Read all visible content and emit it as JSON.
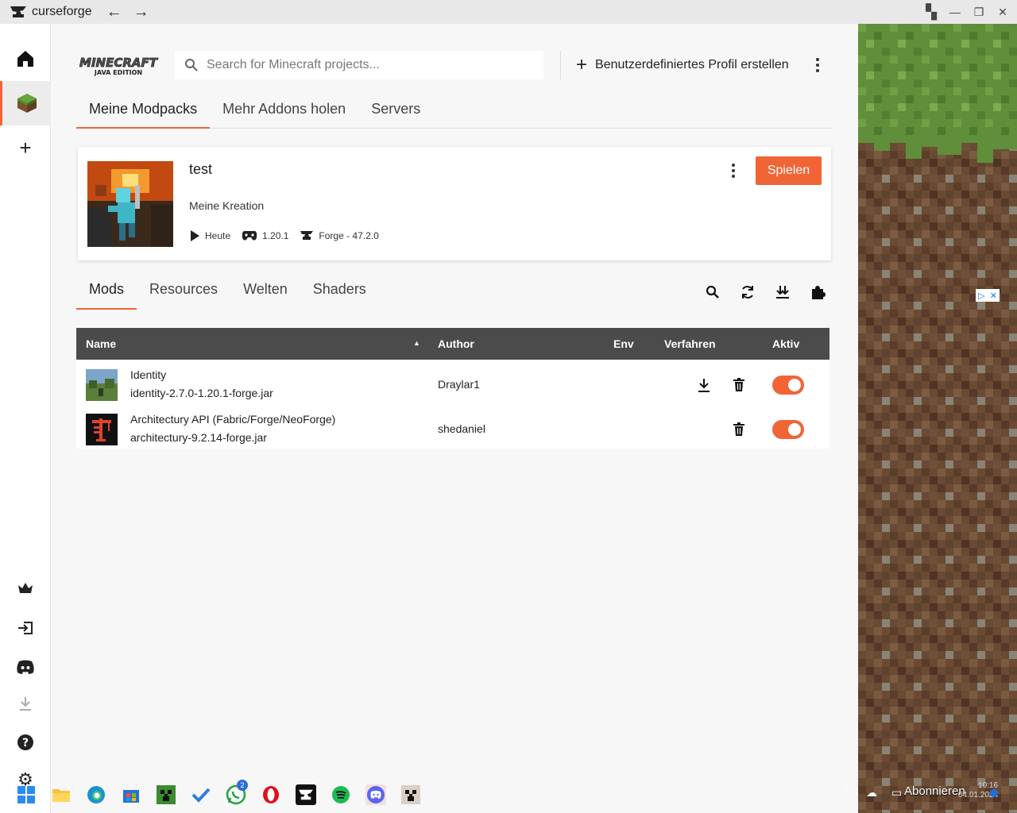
{
  "app": {
    "name": "curseforge"
  },
  "search": {
    "placeholder": "Search for Minecraft projects..."
  },
  "header": {
    "create_profile_label": "Benutzerdefiniertes Profil erstellen"
  },
  "top_tabs": [
    "Meine Modpacks",
    "Mehr Addons holen",
    "Servers"
  ],
  "profile": {
    "name": "test",
    "subtitle": "Meine Kreation",
    "last_played": "Heute",
    "version": "1.20.1",
    "loader": "Forge - 47.2.0",
    "play_label": "Spielen"
  },
  "mod_tabs": [
    "Mods",
    "Resources",
    "Welten",
    "Shaders"
  ],
  "table": {
    "headers": {
      "name": "Name",
      "author": "Author",
      "env": "Env",
      "actions": "Verfahren",
      "active": "Aktiv"
    },
    "rows": [
      {
        "name": "Identity",
        "file": "identity-2.7.0-1.20.1-forge.jar",
        "author": "Draylar1",
        "active": true
      },
      {
        "name": "Architectury API (Fabric/Forge/NeoForge)",
        "file": "architectury-9.2.14-forge.jar",
        "author": "shedaniel",
        "active": true
      }
    ]
  },
  "colors": {
    "accent": "#f16436",
    "table_header": "#4b4b4b"
  },
  "taskbar": {
    "whatsapp_badge": "2",
    "subscribe_text": "Abonnieren",
    "time": "10:16",
    "date": "04.01.2024"
  }
}
